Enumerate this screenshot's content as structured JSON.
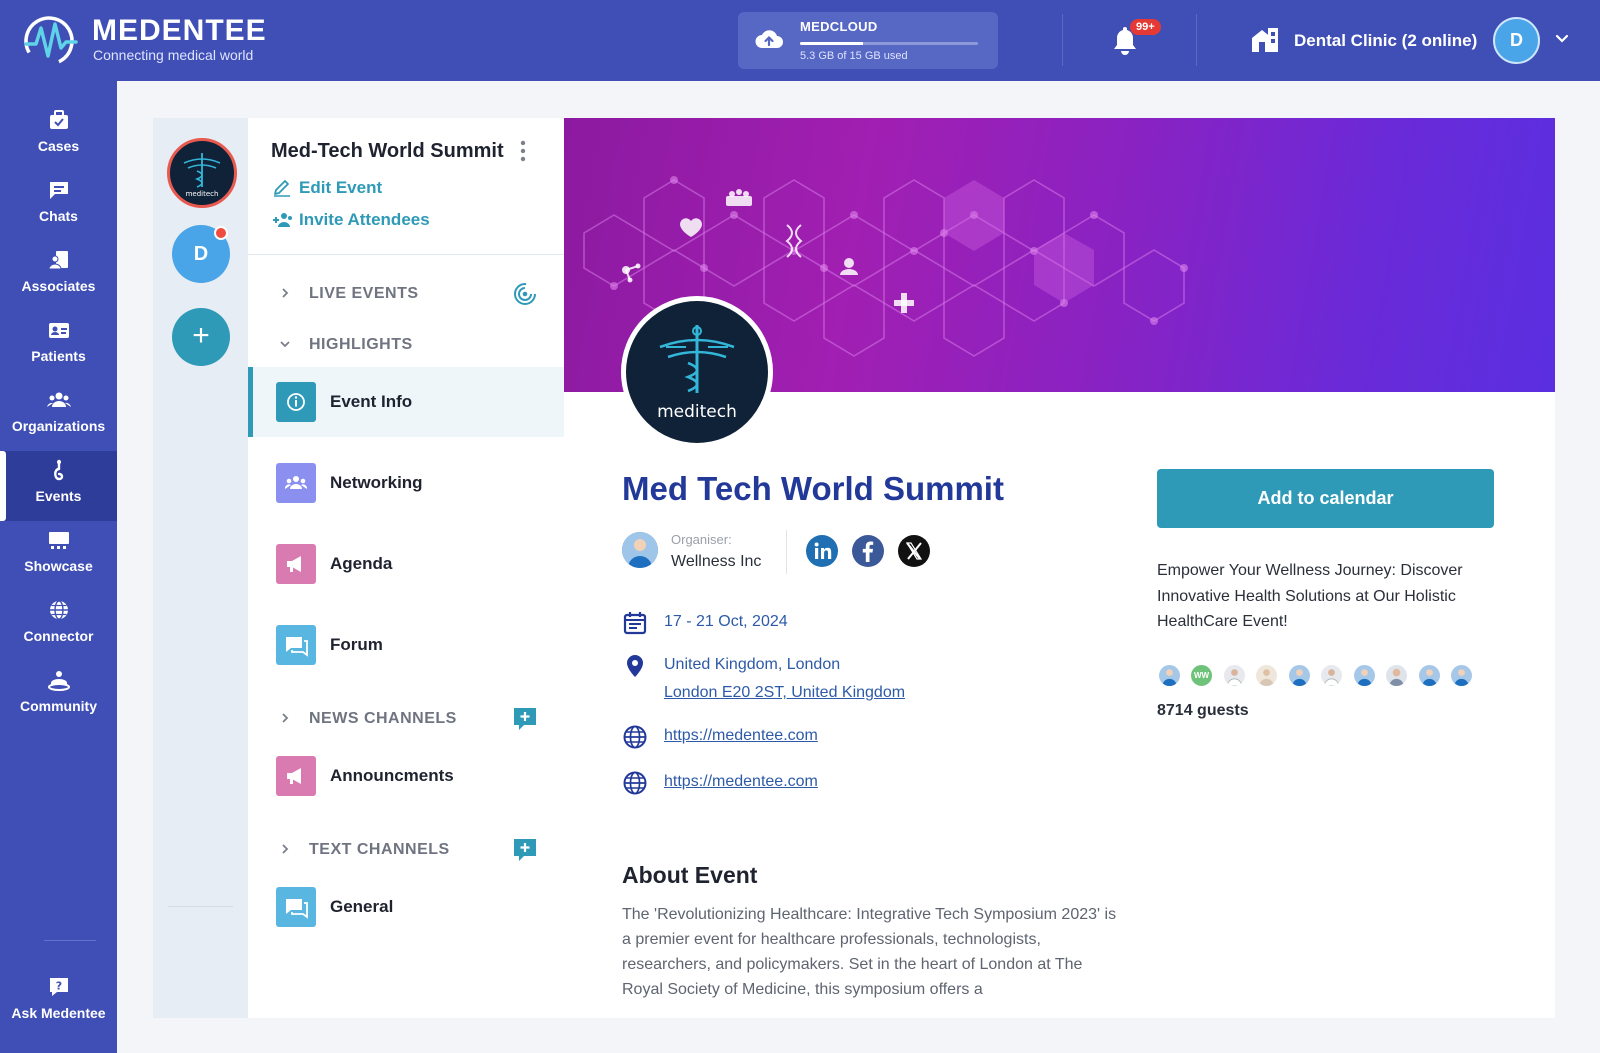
{
  "brand": {
    "name": "MEDENTEE",
    "tagline": "Connecting medical world"
  },
  "storage": {
    "title": "MEDCLOUD",
    "used_text": "5.3 GB of 15 GB used",
    "used_fraction": 0.353
  },
  "notifications": {
    "badge": "99+"
  },
  "clinic": {
    "name": "Dental Clinic (2 online)",
    "avatar_letter": "D"
  },
  "nav": {
    "items": [
      {
        "label": "Cases",
        "icon": "briefcase-icon"
      },
      {
        "label": "Chats",
        "icon": "chat-icon"
      },
      {
        "label": "Associates",
        "icon": "associates-icon"
      },
      {
        "label": "Patients",
        "icon": "id-card-icon"
      },
      {
        "label": "Organizations",
        "icon": "people-group-icon"
      },
      {
        "label": "Events",
        "icon": "events-icon",
        "active": true
      },
      {
        "label": "Showcase",
        "icon": "showcase-icon"
      },
      {
        "label": "Connector",
        "icon": "globe-icon"
      },
      {
        "label": "Community",
        "icon": "community-icon"
      }
    ],
    "help": {
      "label": "Ask Medentee",
      "icon": "help-icon"
    }
  },
  "servers": {
    "logo_text": "meditech",
    "second_letter": "D",
    "add_label": "+"
  },
  "event_panel": {
    "title": "Med-Tech World Summit",
    "edit_label": "Edit Event",
    "invite_label": "Invite Attendees",
    "sections": {
      "live": "LIVE EVENTS",
      "highlights": "HIGHLIGHTS",
      "news": "NEWS CHANNELS",
      "text": "TEXT CHANNELS"
    },
    "channels": {
      "event_info": "Event Info",
      "networking": "Networking",
      "agenda": "Agenda",
      "forum": "Forum",
      "announcements": "Announcments",
      "general": "General"
    }
  },
  "event": {
    "logo_text": "meditech",
    "title": "Med Tech World Summit",
    "organiser_caption": "Organiser:",
    "organiser_name": "Wellness Inc",
    "dates": "17 - 21 Oct, 2024",
    "location_line1": "United Kingdom, London",
    "location_line2": "London E20 2ST, United Kingdom",
    "website1": "https://medentee.com",
    "website2": "https://medentee.com",
    "about_title": "About Event",
    "about_text": "The 'Revolutionizing Healthcare: Integrative Tech Symposium 2023' is a premier event for healthcare professionals, technologists, researchers, and policymakers. Set in the heart of London at The Royal Society of Medicine, this symposium offers a",
    "calendar_label": "Add to calendar",
    "promo_text": "Empower Your Wellness Journey: Discover Innovative Health Solutions at Our Holistic HealthCare Event!",
    "guest_count_label": "8714 guests",
    "guest_initials_2": "WW"
  },
  "colors": {
    "primary": "#3f4fb5",
    "accent": "#2e9ab8",
    "title": "#22399a",
    "alert": "#e53935"
  }
}
